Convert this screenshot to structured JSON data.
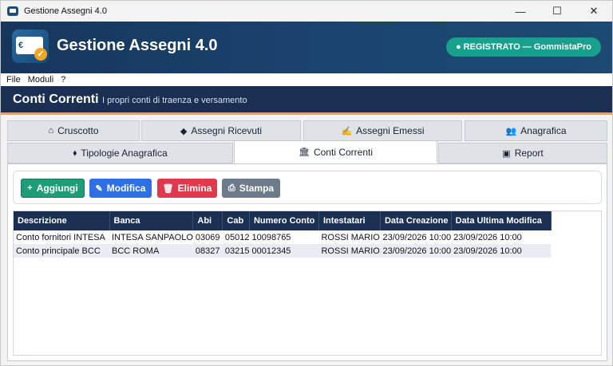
{
  "window": {
    "title": "Gestione Assegni 4.0"
  },
  "win_controls": {
    "minimize": "—",
    "maximize": "☐",
    "close": "✕"
  },
  "header": {
    "logo_symbol": "€",
    "logo_check": "✓",
    "app_title": "Gestione Assegni 4.0",
    "registration_badge": "● REGISTRATO — GommistaPro",
    "colors": {
      "header_bg": "#1b4570",
      "badge_bg": "#17a08b",
      "accent": "#f0a821"
    }
  },
  "menu": {
    "items": [
      "File",
      "Moduli",
      "?"
    ]
  },
  "section": {
    "title": "Conti Correnti",
    "subtitle": "I propri conti di traenza e versamento"
  },
  "tabs": {
    "row1": [
      {
        "icon": "home-icon",
        "glyph": "⌂",
        "label": "Cruscotto"
      },
      {
        "icon": "diamond-icon",
        "glyph": "◆",
        "label": "Assegni Ricevuti"
      },
      {
        "icon": "signature-icon",
        "glyph": "✍",
        "label": "Assegni Emessi"
      },
      {
        "icon": "users-icon",
        "glyph": "👥",
        "label": "Anagrafica"
      }
    ],
    "row2": [
      {
        "icon": "tag-icon",
        "glyph": "⬧",
        "label": "Tipologie Anagrafica"
      },
      {
        "icon": "bank-icon",
        "glyph": "🏛",
        "label": "Conti Correnti",
        "active": true
      },
      {
        "icon": "report-icon",
        "glyph": "▣",
        "label": "Report"
      }
    ]
  },
  "toolbar": {
    "add": {
      "glyph": "+",
      "label": "Aggiungi"
    },
    "edit": {
      "glyph": "✎",
      "label": "Modifica"
    },
    "delete": {
      "glyph": "🗑",
      "label": "Elimina"
    },
    "print": {
      "glyph": "⎙",
      "label": "Stampa"
    }
  },
  "table": {
    "columns": [
      "Descrizione",
      "Banca",
      "Abi",
      "Cab",
      "Numero Conto",
      "Intestatari",
      "Data Creazione",
      "Data Ultima Modifica"
    ],
    "rows": [
      [
        "Conto fornitori INTESA",
        "INTESA SANPAOLO",
        "03069",
        "05012",
        "10098765",
        "ROSSI MARIO",
        "23/09/2026 10:00",
        "23/09/2026 10:00"
      ],
      [
        "Conto principale BCC",
        "BCC ROMA",
        "08327",
        "03215",
        "00012345",
        "ROSSI MARIO",
        "23/09/2026 10:00",
        "23/09/2026 10:00"
      ]
    ]
  }
}
